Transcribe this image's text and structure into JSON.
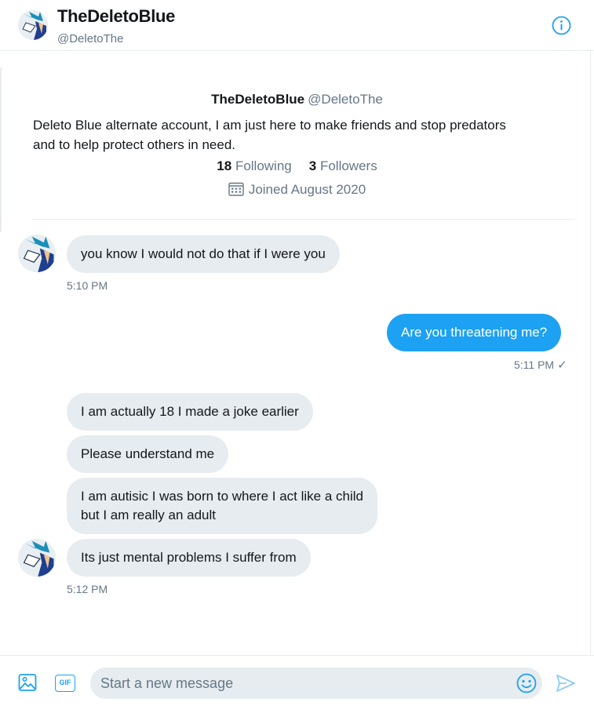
{
  "header": {
    "display_name": "TheDeletoBlue",
    "handle": "@DeletoThe",
    "info_icon": "info-icon"
  },
  "profile": {
    "display_name": "TheDeletoBlue",
    "handle": "@DeletoThe",
    "bio_line1": "Deleto Blue alternate account, I am just here to make friends and stop predators",
    "bio_line2": "and to help protect others in need.",
    "following_count": "18",
    "following_label": "Following",
    "followers_count": "3",
    "followers_label": "Followers",
    "joined": "Joined August 2020",
    "joined_icon": "calendar-icon"
  },
  "messages": [
    {
      "direction": "incoming",
      "lines": [
        "you know I would not do that if I were you"
      ]
    },
    {
      "direction": "outgoing",
      "lines": [
        "Are you threatening me?"
      ]
    },
    {
      "direction": "incoming",
      "lines": [
        "I am actually 18 I made a joke earlier"
      ]
    },
    {
      "direction": "incoming",
      "lines": [
        "Please understand me"
      ]
    },
    {
      "direction": "incoming",
      "lines": [
        "I am autisic I was born to where I act like a child",
        "but I am really an adult"
      ]
    },
    {
      "direction": "incoming",
      "lines": [
        "Its just mental problems I suffer from"
      ]
    }
  ],
  "timestamps": {
    "t1": "5:10 PM",
    "t2": "5:11 PM",
    "t2_status": "✓",
    "t3": "5:12 PM"
  },
  "composer": {
    "placeholder": "Start a new message",
    "media_icon": "image-icon",
    "gif_label": "GIF",
    "emoji_icon": "emoji-icon",
    "send_icon": "send-icon"
  },
  "colors": {
    "accent": "#1da1f2",
    "incoming_bubble": "#e6ecf0",
    "secondary_text": "#657786",
    "primary_text": "#14171a"
  }
}
